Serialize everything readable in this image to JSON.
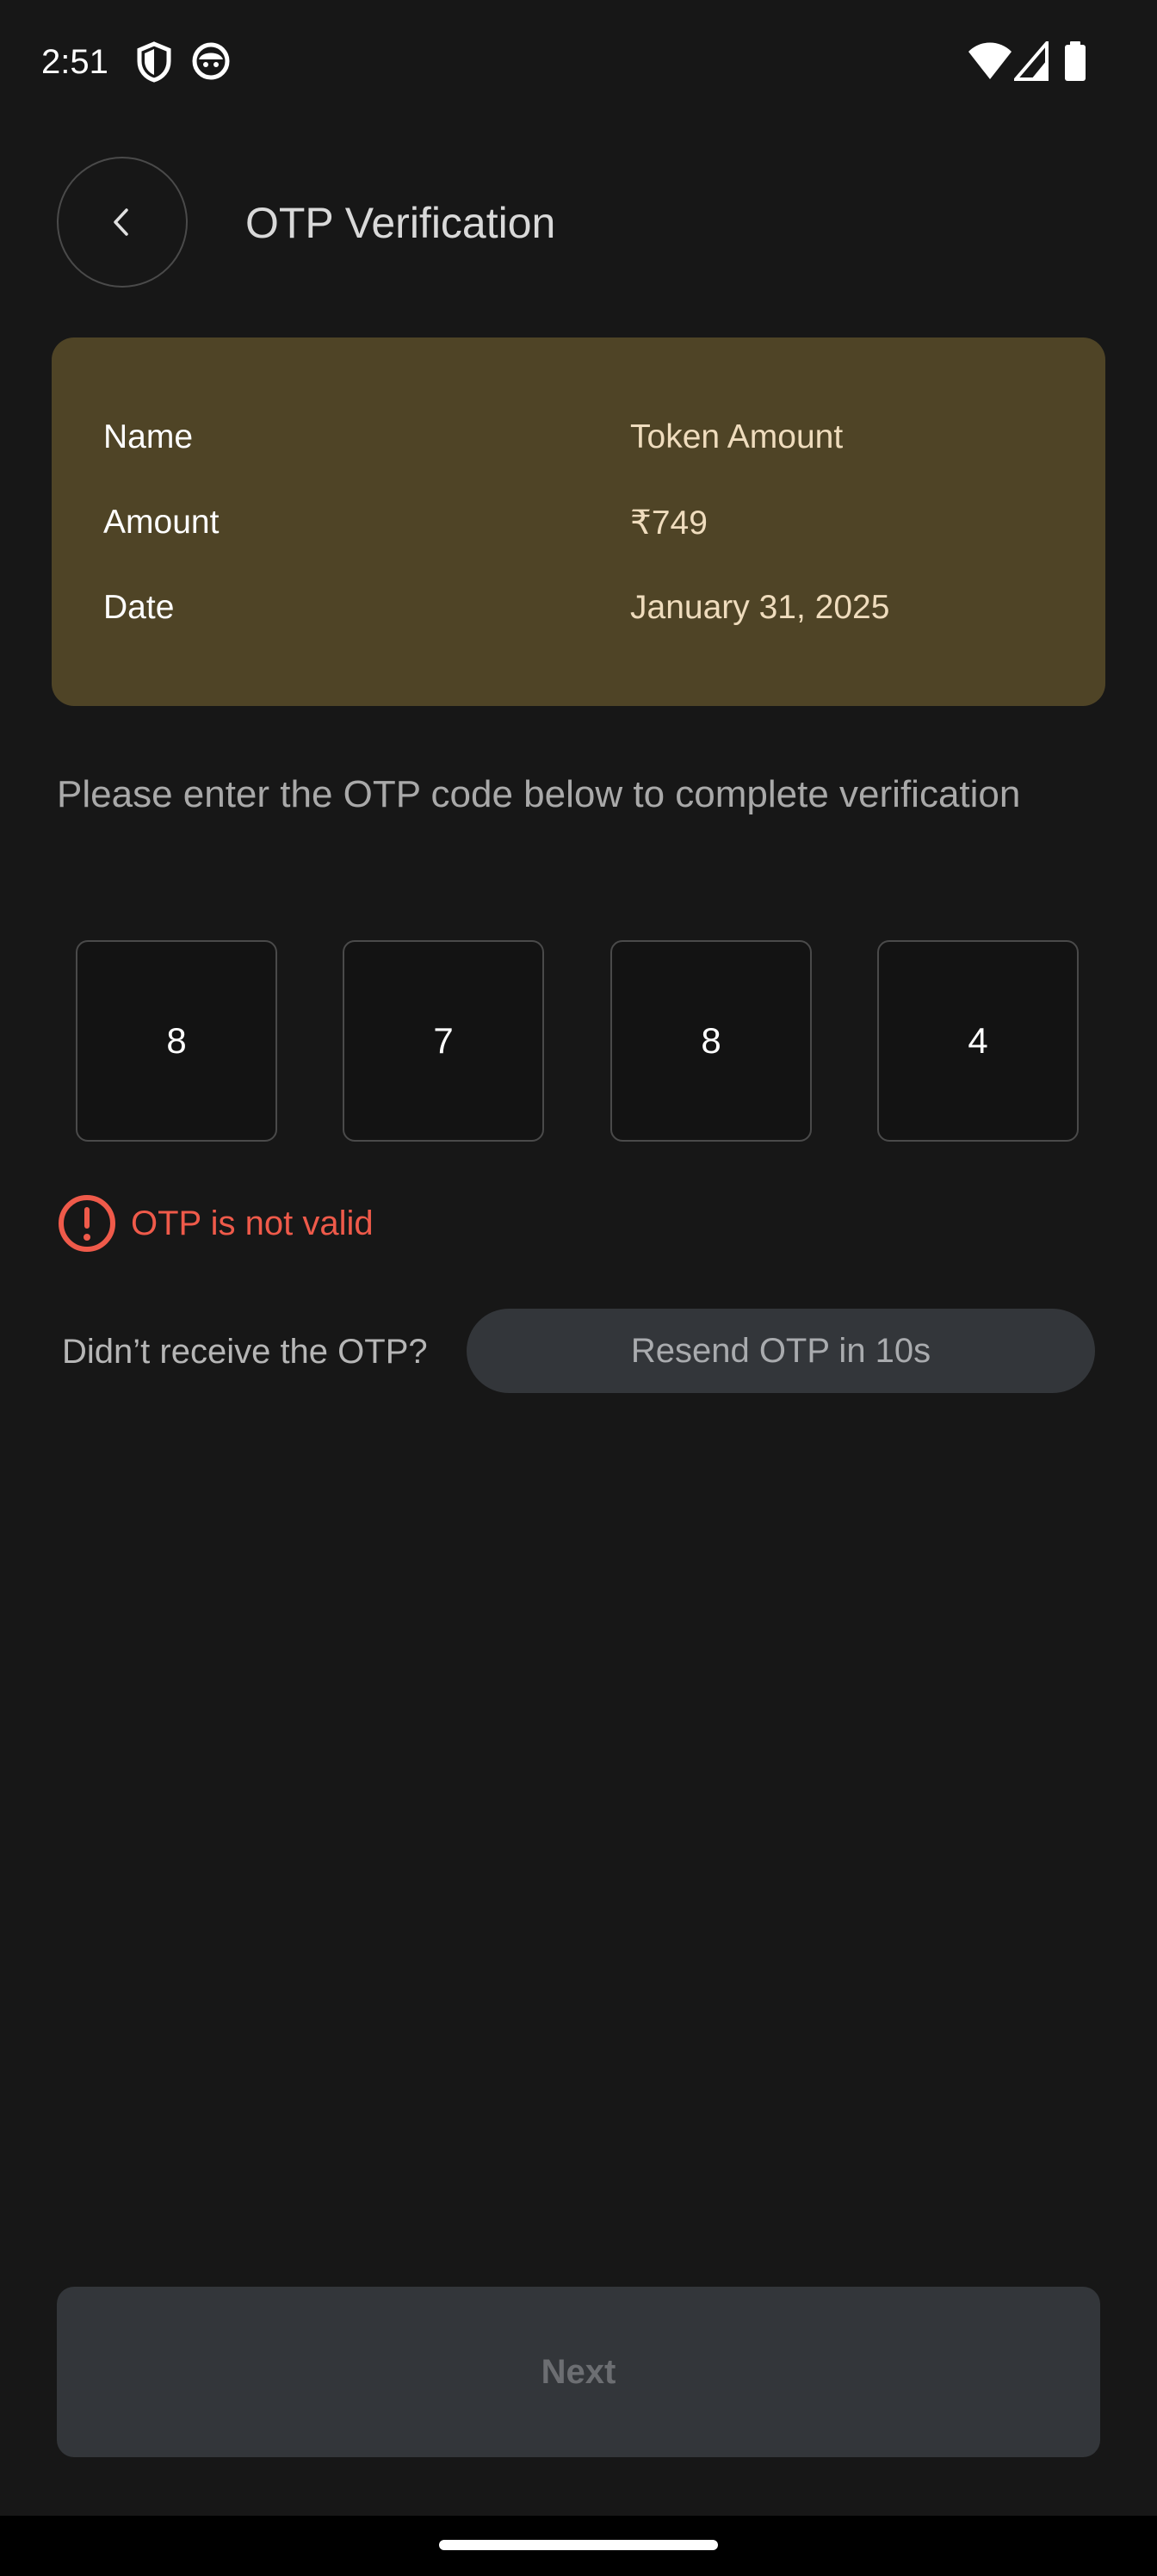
{
  "status_bar": {
    "time": "2:51"
  },
  "header": {
    "title": "OTP Verification"
  },
  "details": {
    "rows": [
      {
        "label": "Name",
        "value": "Token Amount"
      },
      {
        "label": "Amount",
        "value": "₹749"
      },
      {
        "label": "Date",
        "value": "January 31, 2025"
      }
    ]
  },
  "instructions": "Please enter the OTP code below to complete verification",
  "otp": {
    "digits": [
      "8",
      "7",
      "8",
      "4"
    ]
  },
  "error": {
    "message": "OTP is not valid"
  },
  "resend": {
    "prompt": "Didn’t receive the OTP?",
    "button_label": "Resend OTP in 10s"
  },
  "footer": {
    "next_label": "Next"
  },
  "colors": {
    "background": "#171717",
    "card": "#4f4426",
    "card_value": "#efdcbd",
    "error": "#ef5a4a",
    "button_disabled": "#33363a"
  }
}
